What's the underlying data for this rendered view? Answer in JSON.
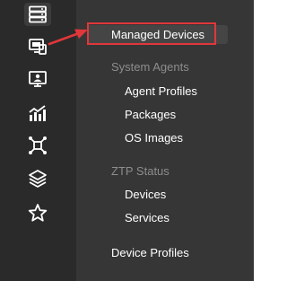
{
  "rail": {
    "icons": [
      {
        "name": "server-rack-icon"
      },
      {
        "name": "device-monitor-icon"
      },
      {
        "name": "agent-monitor-icon"
      },
      {
        "name": "analytics-chart-icon"
      },
      {
        "name": "network-nodes-icon"
      },
      {
        "name": "layers-icon"
      },
      {
        "name": "star-icon"
      }
    ]
  },
  "menu": {
    "managed_devices": "Managed Devices",
    "system_agents_header": "System Agents",
    "agent_profiles": "Agent Profiles",
    "packages": "Packages",
    "os_images": "OS Images",
    "ztp_status_header": "ZTP Status",
    "devices": "Devices",
    "services": "Services",
    "device_profiles": "Device Profiles"
  },
  "colors": {
    "annotation": "#e0373a",
    "rail_bg": "#2a2a2a",
    "panel_bg": "#363636",
    "header_text": "#8d8d8d"
  }
}
